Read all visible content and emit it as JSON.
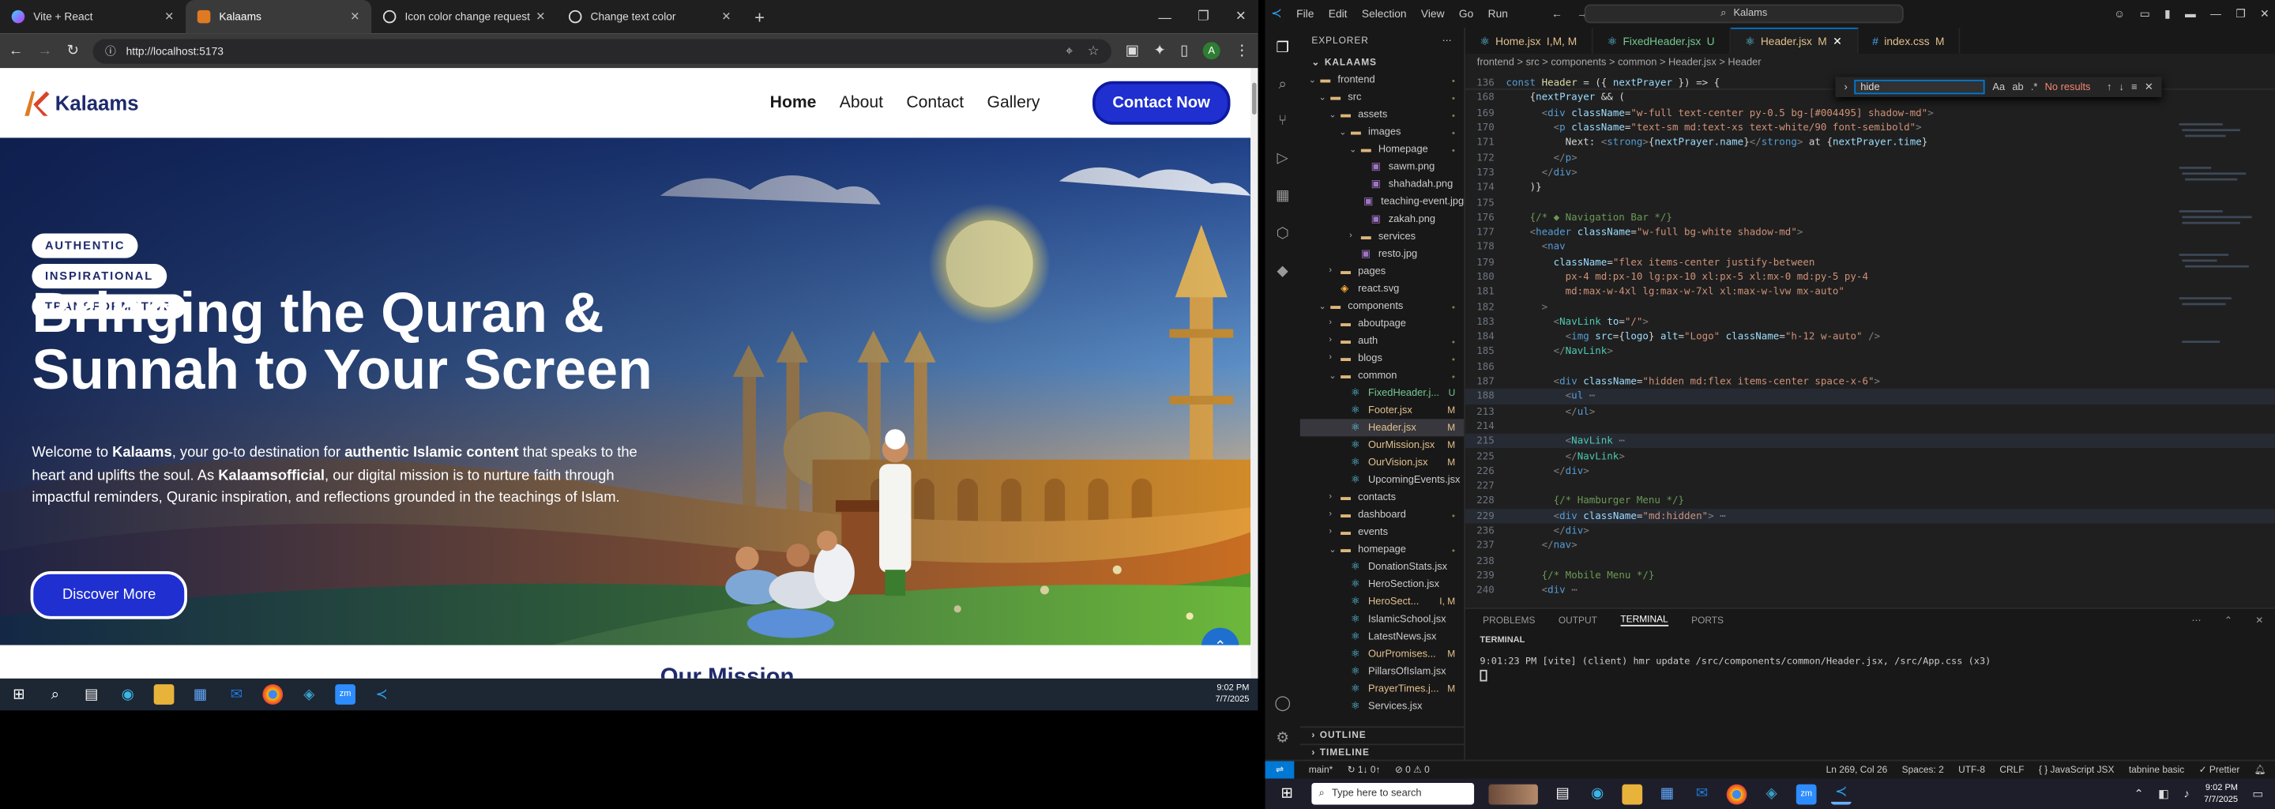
{
  "browser": {
    "tabs": [
      {
        "label": "Vite + React",
        "active": false,
        "icon": "vite-icon"
      },
      {
        "label": "Kalaams",
        "active": true,
        "icon": "kalaams-icon"
      },
      {
        "label": "Icon color change request",
        "active": false,
        "icon": "chatgpt-icon"
      },
      {
        "label": "Change text color",
        "active": false,
        "icon": "chatgpt-icon"
      }
    ],
    "url": "http://localhost:5173"
  },
  "site": {
    "logo_text": "Kalaams",
    "nav": [
      "Home",
      "About",
      "Contact",
      "Gallery"
    ],
    "cta": "Contact Now",
    "pills": [
      "AUTHENTIC",
      "INSPIRATIONAL",
      "TRANSFORMATIVE"
    ],
    "headline": "Bringing the Quran & Sunnah to Your Screen",
    "lead_parts": [
      {
        "text": "Welcome to ",
        "bold": false
      },
      {
        "text": "Kalaams",
        "bold": true
      },
      {
        "text": ", your go-to destination for ",
        "bold": false
      },
      {
        "text": "authentic Islamic content",
        "bold": true
      },
      {
        "text": " that speaks to the heart and uplifts the soul. As ",
        "bold": false
      },
      {
        "text": "Kalaamsofficial",
        "bold": true
      },
      {
        "text": ", our digital mission is to nurture faith through impactful reminders, Quranic inspiration, and reflections grounded in the teachings of Islam.",
        "bold": false
      }
    ],
    "discover_button": "Discover More",
    "next_section_peek": "Our Mission"
  },
  "left_taskbar": {
    "time": "9:02 PM",
    "date": "7/7/2025"
  },
  "vscode": {
    "menu": [
      "File",
      "Edit",
      "Selection",
      "View",
      "Go",
      "Run"
    ],
    "command_center": "Kalams",
    "explorer_title": "EXPLORER",
    "root": "KALAAMS",
    "tree": [
      {
        "label": "frontend",
        "depth": 0,
        "type": "folder",
        "open": true,
        "status": "dot"
      },
      {
        "label": "src",
        "depth": 1,
        "type": "folder",
        "open": true,
        "status": "dot"
      },
      {
        "label": "assets",
        "depth": 2,
        "type": "folder",
        "open": true,
        "status": "dot"
      },
      {
        "label": "images",
        "depth": 3,
        "type": "folder",
        "open": true,
        "status": "dot"
      },
      {
        "label": "Homepage",
        "depth": 4,
        "type": "folder",
        "open": true,
        "status": "dot"
      },
      {
        "label": "sawm.png",
        "depth": 5,
        "type": "img",
        "status": ""
      },
      {
        "label": "shahadah.png",
        "depth": 5,
        "type": "img",
        "status": ""
      },
      {
        "label": "teaching-event.jpg",
        "depth": 5,
        "type": "img",
        "status": ""
      },
      {
        "label": "zakah.png",
        "depth": 5,
        "type": "img",
        "status": ""
      },
      {
        "label": "services",
        "depth": 4,
        "type": "folder",
        "open": false,
        "status": ""
      },
      {
        "label": "resto.jpg",
        "depth": 4,
        "type": "img",
        "status": ""
      },
      {
        "label": "pages",
        "depth": 2,
        "type": "folder",
        "open": false,
        "status": ""
      },
      {
        "label": "react.svg",
        "depth": 2,
        "type": "svg",
        "status": ""
      },
      {
        "label": "components",
        "depth": 1,
        "type": "folder",
        "open": true,
        "status": "dot"
      },
      {
        "label": "aboutpage",
        "depth": 2,
        "type": "folder",
        "open": false,
        "status": ""
      },
      {
        "label": "auth",
        "depth": 2,
        "type": "folder",
        "open": false,
        "status": "dot"
      },
      {
        "label": "blogs",
        "depth": 2,
        "type": "folder",
        "open": false,
        "status": "dot"
      },
      {
        "label": "common",
        "depth": 2,
        "type": "folder",
        "open": true,
        "status": "dot"
      },
      {
        "label": "FixedHeader.j...",
        "depth": 3,
        "type": "jsx",
        "status": "U"
      },
      {
        "label": "Footer.jsx",
        "depth": 3,
        "type": "jsx",
        "status": "M"
      },
      {
        "label": "Header.jsx",
        "depth": 3,
        "type": "jsx",
        "status": "M",
        "selected": true
      },
      {
        "label": "OurMission.jsx",
        "depth": 3,
        "type": "jsx",
        "status": "M"
      },
      {
        "label": "OurVision.jsx",
        "depth": 3,
        "type": "jsx",
        "status": "M"
      },
      {
        "label": "UpcomingEvents.jsx",
        "depth": 3,
        "type": "jsx",
        "status": ""
      },
      {
        "label": "contacts",
        "depth": 2,
        "type": "folder",
        "open": false,
        "status": ""
      },
      {
        "label": "dashboard",
        "depth": 2,
        "type": "folder",
        "open": false,
        "status": "dot"
      },
      {
        "label": "events",
        "depth": 2,
        "type": "folder",
        "open": false,
        "status": ""
      },
      {
        "label": "homepage",
        "depth": 2,
        "type": "folder",
        "open": true,
        "status": "dot"
      },
      {
        "label": "DonationStats.jsx",
        "depth": 3,
        "type": "jsx",
        "status": ""
      },
      {
        "label": "HeroSection.jsx",
        "depth": 3,
        "type": "jsx",
        "status": ""
      },
      {
        "label": "HeroSect...",
        "depth": 3,
        "type": "jsx",
        "status": "I, M"
      },
      {
        "label": "IslamicSchool.jsx",
        "depth": 3,
        "type": "jsx",
        "status": ""
      },
      {
        "label": "LatestNews.jsx",
        "depth": 3,
        "type": "jsx",
        "status": ""
      },
      {
        "label": "OurPromises...",
        "depth": 3,
        "type": "jsx",
        "status": "M"
      },
      {
        "label": "PillarsOfIslam.jsx",
        "depth": 3,
        "type": "jsx",
        "status": ""
      },
      {
        "label": "PrayerTimes.j...",
        "depth": 3,
        "type": "jsx",
        "status": "M"
      },
      {
        "label": "Services.jsx",
        "depth": 3,
        "type": "jsx",
        "status": ""
      }
    ],
    "outline": "OUTLINE",
    "timeline": "TIMELINE",
    "editor_tabs": [
      {
        "label": "Home.jsx",
        "status": "I,M, M",
        "active": false
      },
      {
        "label": "FixedHeader.jsx",
        "status": "U",
        "active": false
      },
      {
        "label": "Header.jsx",
        "status": "M",
        "active": true
      },
      {
        "label": "index.css",
        "status": "M",
        "active": false
      }
    ],
    "breadcrumb": "frontend > src > components > common > Header.jsx > Header",
    "find_query": "hide",
    "find_result": "No results",
    "code_lines": [
      {
        "n": "136",
        "html": "<span class='k'>const</span> <span class='y'>Header</span> <span class='w'>= ({</span> <span class='p'>nextPrayer</span> <span class='w'>}) =&gt; {</span>"
      },
      {
        "n": "168",
        "html": "    <span class='w'>{</span><span class='p'>nextPrayer</span> <span class='w'>&amp;&amp; (</span>"
      },
      {
        "n": "169",
        "html": "      <span class='g'>&lt;</span><span class='k'>div</span> <span class='p'>className</span><span class='w'>=</span><span class='s'>\"w-full text-center py-0.5 bg-[#004495] shadow-md\"</span><span class='g'>&gt;</span>"
      },
      {
        "n": "170",
        "html": "        <span class='g'>&lt;</span><span class='k'>p</span> <span class='p'>className</span><span class='w'>=</span><span class='s'>\"text-sm md:text-xs text-white/90 font-semibold\"</span><span class='g'>&gt;</span>"
      },
      {
        "n": "171",
        "html": "          <span class='w'>Next: </span><span class='g'>&lt;</span><span class='k'>strong</span><span class='g'>&gt;</span><span class='w'>{</span><span class='p'>nextPrayer.name</span><span class='w'>}</span><span class='g'>&lt;/</span><span class='k'>strong</span><span class='g'>&gt;</span><span class='w'> at {</span><span class='p'>nextPrayer.time</span><span class='w'>}</span>"
      },
      {
        "n": "172",
        "html": "        <span class='g'>&lt;/</span><span class='k'>p</span><span class='g'>&gt;</span>"
      },
      {
        "n": "173",
        "html": "      <span class='g'>&lt;/</span><span class='k'>div</span><span class='g'>&gt;</span>"
      },
      {
        "n": "174",
        "html": "    <span class='w'>)}</span>"
      },
      {
        "n": "175",
        "html": ""
      },
      {
        "n": "176",
        "html": "    <span class='c'>{/* ◆ Navigation Bar */}</span>"
      },
      {
        "n": "177",
        "html": "    <span class='g'>&lt;</span><span class='k'>header</span> <span class='p'>className</span><span class='w'>=</span><span class='s'>\"w-full bg-white shadow-md\"</span><span class='g'>&gt;</span>"
      },
      {
        "n": "178",
        "html": "      <span class='g'>&lt;</span><span class='k'>nav</span>"
      },
      {
        "n": "179",
        "html": "        <span class='p'>className</span><span class='w'>=</span><span class='s'>\"flex items-center justify-between</span>"
      },
      {
        "n": "180",
        "html": "<span class='s'>          px-4 md:px-10 lg:px-10 xl:px-5 xl:mx-0 md:py-5 py-4</span>"
      },
      {
        "n": "181",
        "html": "<span class='s'>          md:max-w-4xl lg:max-w-7xl xl:max-w-lvw mx-auto\"</span>"
      },
      {
        "n": "182",
        "html": "      <span class='g'>&gt;</span>"
      },
      {
        "n": "183",
        "html": "        <span class='g'>&lt;</span><span class='t'>NavLink</span> <span class='p'>to</span><span class='w'>=</span><span class='s'>\"/\"</span><span class='g'>&gt;</span>"
      },
      {
        "n": "184",
        "html": "          <span class='g'>&lt;</span><span class='k'>img</span> <span class='p'>src</span><span class='w'>={</span><span class='p'>logo</span><span class='w'>}</span> <span class='p'>alt</span><span class='w'>=</span><span class='s'>\"Logo\"</span> <span class='p'>className</span><span class='w'>=</span><span class='s'>\"h-12 w-auto\"</span> <span class='g'>/&gt;</span>"
      },
      {
        "n": "185",
        "html": "        <span class='g'>&lt;/</span><span class='t'>NavLink</span><span class='g'>&gt;</span>"
      },
      {
        "n": "186",
        "html": ""
      },
      {
        "n": "187",
        "html": "        <span class='g'>&lt;</span><span class='k'>div</span> <span class='p'>className</span><span class='w'>=</span><span class='s'>\"hidden md:flex items-center space-x-6\"</span><span class='g'>&gt;</span>"
      },
      {
        "n": "188",
        "html": "          <span class='g'>&lt;</span><span class='k'>ul</span><span class='g'> ⋯</span>"
      },
      {
        "n": "213",
        "html": "          <span class='g'>&lt;/</span><span class='k'>ul</span><span class='g'>&gt;</span>"
      },
      {
        "n": "214",
        "html": ""
      },
      {
        "n": "215",
        "html": "          <span class='g'>&lt;</span><span class='t'>NavLink</span><span class='g'> ⋯</span>"
      },
      {
        "n": "225",
        "html": "          <span class='g'>&lt;/</span><span class='t'>NavLink</span><span class='g'>&gt;</span>"
      },
      {
        "n": "226",
        "html": "        <span class='g'>&lt;/</span><span class='k'>div</span><span class='g'>&gt;</span>"
      },
      {
        "n": "227",
        "html": ""
      },
      {
        "n": "228",
        "html": "        <span class='c'>{/* Hamburger Menu */}</span>"
      },
      {
        "n": "229",
        "html": "        <span class='g'>&lt;</span><span class='k'>div</span> <span class='p'>className</span><span class='w'>=</span><span class='s'>\"md:hidden\"</span><span class='g'>&gt; ⋯</span>"
      },
      {
        "n": "236",
        "html": "        <span class='g'>&lt;/</span><span class='k'>div</span><span class='g'>&gt;</span>"
      },
      {
        "n": "237",
        "html": "      <span class='g'>&lt;/</span><span class='k'>nav</span><span class='g'>&gt;</span>"
      },
      {
        "n": "238",
        "html": ""
      },
      {
        "n": "239",
        "html": "      <span class='c'>{/* Mobile Menu */}</span>"
      },
      {
        "n": "240",
        "html": "      <span class='g'>&lt;</span><span class='k'>div</span><span class='g'> ⋯</span>"
      }
    ],
    "panel_tabs": [
      "PROBLEMS",
      "OUTPUT",
      "TERMINAL",
      "PORTS"
    ],
    "terminal_title": "TERMINAL",
    "terminal_line": "9:01:23 PM [vite] (client) hmr update /src/components/common/Header.jsx, /src/App.css (x3)",
    "status": {
      "branch": "main*",
      "sync": "↻ 1↓ 0↑",
      "problems": "⊘ 0 ⚠ 0",
      "position": "Ln 269, Col 26",
      "spaces": "Spaces: 2",
      "encoding": "UTF-8",
      "eol": "CRLF",
      "language": "{ } JavaScript JSX",
      "tabnine": "tabnine basic",
      "prettier": "✓ Prettier"
    }
  },
  "right_taskbar": {
    "search_placeholder": "Type here to search",
    "time": "9:02 PM",
    "date": "7/7/2025"
  },
  "colors": {
    "brand_blue": "#1f2fd0",
    "brand_navy": "#1e2a6b",
    "vscode_accent": "#0078d4"
  }
}
